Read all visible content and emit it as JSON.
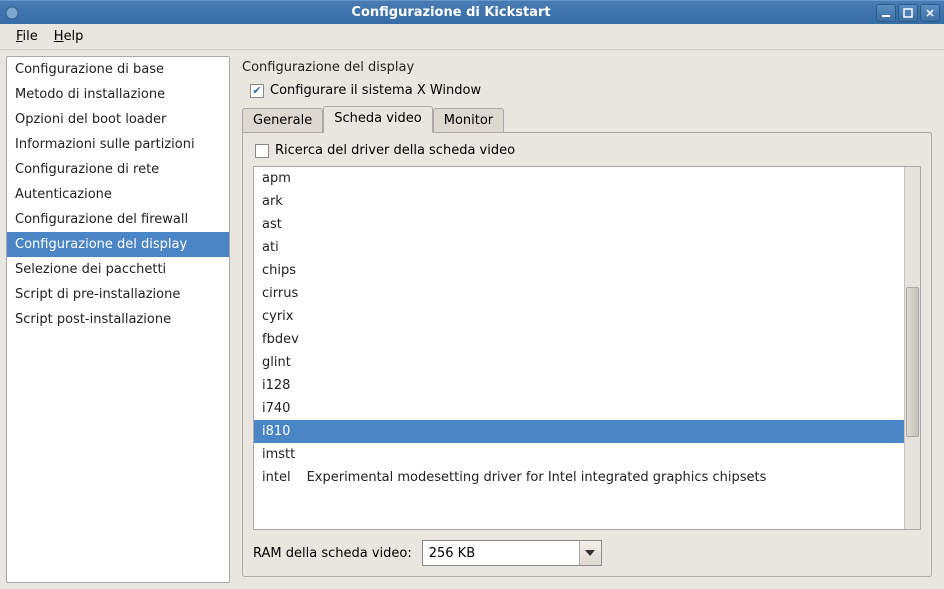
{
  "window": {
    "title": "Configurazione di Kickstart"
  },
  "menubar": {
    "file": "File",
    "help": "Help"
  },
  "sidebar": {
    "items": [
      "Configurazione di base",
      "Metodo di installazione",
      "Opzioni del boot loader",
      "Informazioni sulle partizioni",
      "Configurazione di rete",
      "Autenticazione",
      "Configurazione del firewall",
      "Configurazione del display",
      "Selezione dei pacchetti",
      "Script di pre-installazione",
      "Script post-installazione"
    ],
    "selected_index": 7
  },
  "panel": {
    "title": "Configurazione del display",
    "configure_x_label": "Configurare il sistema X Window",
    "configure_x_checked": true,
    "tabs": [
      "Generale",
      "Scheda video",
      "Monitor"
    ],
    "active_tab": 1,
    "probe_label": "Ricerca del driver della scheda video",
    "probe_checked": false,
    "drivers": [
      "apm",
      "ark",
      "ast",
      "ati",
      "chips",
      "cirrus",
      "cyrix",
      "fbdev",
      "glint",
      "i128",
      "i740",
      "i810",
      "imstt",
      "intel"
    ],
    "driver_extra": {
      "intel": "Experimental modesetting driver for Intel integrated graphics chipsets"
    },
    "selected_driver": "i810",
    "ram_label": "RAM della scheda video:",
    "ram_value": "256 KB"
  }
}
